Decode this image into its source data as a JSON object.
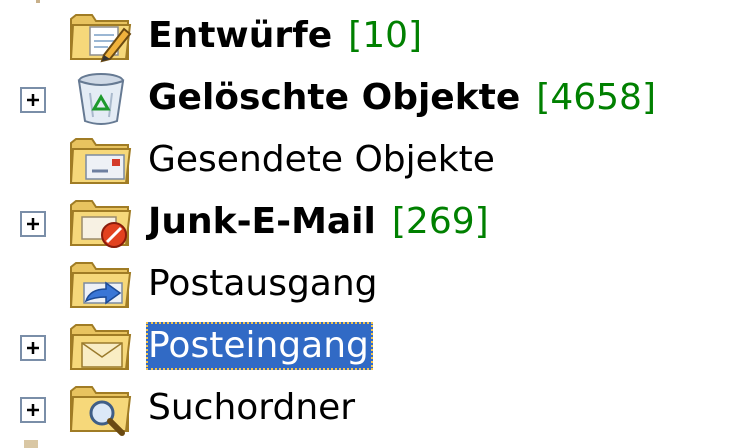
{
  "colors": {
    "selection_bg": "#316ac5",
    "selection_text": "#ffffff",
    "unread_count": "#008000",
    "focus_outline": "#f4c44e",
    "folder_yellow": "#f6d87a"
  },
  "folders": [
    {
      "label": "Entwürfe",
      "count": "[10]",
      "bold": true,
      "expandable": false,
      "selected": false,
      "icon": "drafts-folder-icon"
    },
    {
      "label": "Gelöschte Objekte",
      "count": "[4658]",
      "bold": true,
      "expandable": true,
      "selected": false,
      "icon": "recycle-bin-icon"
    },
    {
      "label": "Gesendete Objekte",
      "count": "",
      "bold": false,
      "expandable": false,
      "selected": false,
      "icon": "sent-items-folder-icon"
    },
    {
      "label": "Junk-E-Mail",
      "count": "[269]",
      "bold": true,
      "expandable": true,
      "selected": false,
      "icon": "junk-mail-folder-icon"
    },
    {
      "label": "Postausgang",
      "count": "",
      "bold": false,
      "expandable": false,
      "selected": false,
      "icon": "outbox-folder-icon"
    },
    {
      "label": "Posteingang",
      "count": "",
      "bold": false,
      "expandable": true,
      "selected": true,
      "icon": "inbox-folder-icon"
    },
    {
      "label": "Suchordner",
      "count": "",
      "bold": false,
      "expandable": true,
      "selected": false,
      "icon": "search-folder-icon"
    }
  ]
}
